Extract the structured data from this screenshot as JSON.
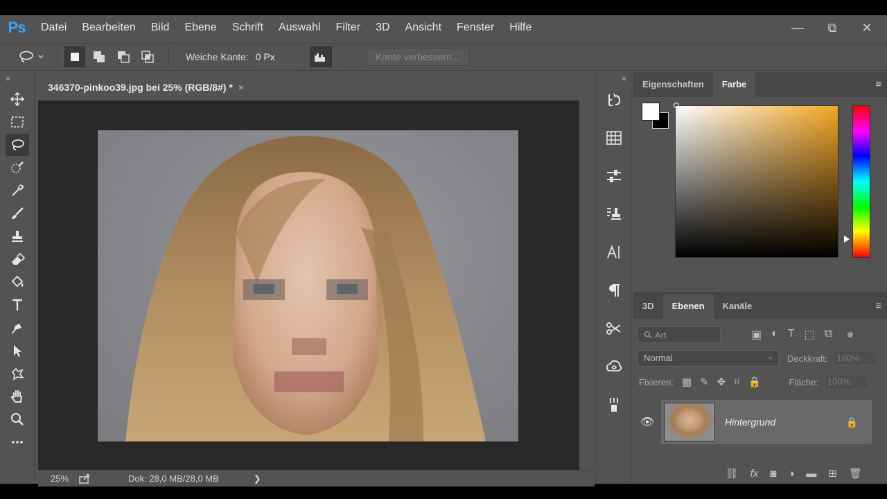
{
  "app": {
    "logo": "Ps"
  },
  "menu": [
    "Datei",
    "Bearbeiten",
    "Bild",
    "Ebene",
    "Schrift",
    "Auswahl",
    "Filter",
    "3D",
    "Ansicht",
    "Fenster",
    "Hilfe"
  ],
  "window_controls": {
    "minimize": "—",
    "restore": "⧉",
    "close": "✕"
  },
  "options": {
    "feather_label": "Weiche Kante:",
    "feather_value": "0 Px",
    "refine_edge": "Kante verbessern..."
  },
  "document": {
    "tab_title": "346370-pinkoo39.jpg bei 25% (RGB/8#) *",
    "tab_close": "×",
    "zoom": "25%",
    "doc_info": "Dok: 28,0 MB/28,0 MB",
    "status_arrow": "❯"
  },
  "panels": {
    "top_tabs": [
      "Eigenschaften",
      "Farbe"
    ],
    "top_active": "Farbe",
    "bottom_tabs": [
      "3D",
      "Ebenen",
      "Kanäle"
    ],
    "bottom_active": "Ebenen",
    "menu_icon": "≡"
  },
  "color": {
    "foreground": "#ffffff",
    "background": "#000000",
    "hue_color": "#f5a623"
  },
  "layers": {
    "filter_placeholder": "Art",
    "blend_mode": "Normal",
    "opacity_label": "Deckkraft:",
    "opacity_value": "100%",
    "lock_label": "Fixieren:",
    "fill_label": "Fläche:",
    "fill_value": "100%",
    "items": [
      {
        "name": "Hintergrund",
        "visible": true,
        "locked": true
      }
    ]
  }
}
